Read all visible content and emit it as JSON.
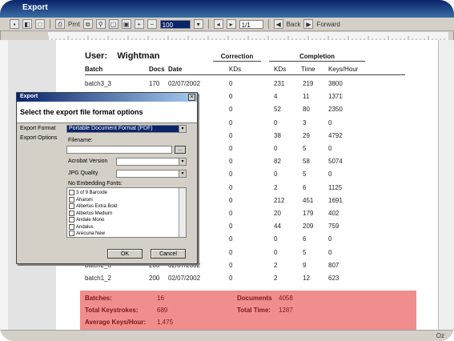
{
  "window": {
    "title": "Export"
  },
  "toolbar": {
    "print_label": "Prnt",
    "zoom_value": "100",
    "page_value": "1/1",
    "back_label": "Back",
    "forward_label": "Forward"
  },
  "report": {
    "user_label": "User:",
    "user_name": "Wightman",
    "headers": {
      "batch": "Batch",
      "docs": "Docs",
      "date": "Date",
      "correction_group": "Correction",
      "corr_kds": "KDs",
      "completion_group": "Completion",
      "comp_kds": "KDs",
      "time": "Time",
      "keys_per_hour": "Keys/Hour"
    },
    "rows": [
      {
        "batch": "batch3_3",
        "docs": "170",
        "date": "02/07/2002",
        "corr": "0",
        "kds": "231",
        "time": "219",
        "kph": "3800"
      },
      {
        "batch": "",
        "docs": "",
        "date": "02",
        "corr": "0",
        "kds": "4",
        "time": "11",
        "kph": "1371"
      },
      {
        "batch": "",
        "docs": "",
        "date": "02",
        "corr": "0",
        "kds": "52",
        "time": "80",
        "kph": "2350"
      },
      {
        "batch": "",
        "docs": "",
        "date": "02",
        "corr": "0",
        "kds": "0",
        "time": "3",
        "kph": "0"
      },
      {
        "batch": "",
        "docs": "",
        "date": "02",
        "corr": "0",
        "kds": "38",
        "time": "29",
        "kph": "4792"
      },
      {
        "batch": "",
        "docs": "",
        "date": "02",
        "corr": "0",
        "kds": "0",
        "time": "5",
        "kph": "0"
      },
      {
        "batch": "",
        "docs": "",
        "date": "02",
        "corr": "0",
        "kds": "82",
        "time": "58",
        "kph": "5074"
      },
      {
        "batch": "",
        "docs": "",
        "date": "02",
        "corr": "0",
        "kds": "0",
        "time": "5",
        "kph": "0"
      },
      {
        "batch": "",
        "docs": "",
        "date": "02",
        "corr": "0",
        "kds": "2",
        "time": "6",
        "kph": "1125"
      },
      {
        "batch": "",
        "docs": "",
        "date": "02",
        "corr": "0",
        "kds": "212",
        "time": "451",
        "kph": "1691"
      },
      {
        "batch": "",
        "docs": "",
        "date": "02",
        "corr": "0",
        "kds": "20",
        "time": "179",
        "kph": "402"
      },
      {
        "batch": "",
        "docs": "",
        "date": "02",
        "corr": "0",
        "kds": "44",
        "time": "209",
        "kph": "759"
      },
      {
        "batch": "",
        "docs": "",
        "date": "02",
        "corr": "0",
        "kds": "0",
        "time": "6",
        "kph": "0"
      },
      {
        "batch": "",
        "docs": "",
        "date": "02",
        "corr": "0",
        "kds": "0",
        "time": "5",
        "kph": "0"
      },
      {
        "batch": "batch2_6",
        "docs": "200",
        "date": "02/07/2002",
        "corr": "0",
        "kds": "2",
        "time": "9",
        "kph": "807"
      },
      {
        "batch": "batch1_2",
        "docs": "200",
        "date": "02/07/2002",
        "corr": "0",
        "kds": "2",
        "time": "12",
        "kph": "623"
      }
    ],
    "summary": {
      "batches_label": "Batches:",
      "batches_value": "16",
      "documents_label": "Documents",
      "documents_value": "4058",
      "keystrokes_label": "Total Keystrokes:",
      "keystrokes_value": "689",
      "total_time_label": "Total Time:",
      "total_time_value": "1287",
      "avg_label": "Average Keys/Hour:",
      "avg_value": "1,475"
    }
  },
  "dialog": {
    "title": "Export",
    "heading": "Select the export file format options",
    "export_format_label": "Export Format",
    "export_format_value": "Portable Document Format (PDF)",
    "export_options_label": "Export Options",
    "filename_label": "Filename:",
    "filename_value": "",
    "browse_label": "...",
    "acrobat_label": "Acrobat Version",
    "acrobat_value": "",
    "jpg_label": "JPG Quality",
    "jpg_value": "",
    "fonts_label": "No Embedding Fonts:",
    "fonts": [
      "3 of 9 Barcode",
      "Aharoni",
      "Albertus Extra Bold",
      "Albertus Medium",
      "Andale Mono",
      "Andalus",
      "Arecuna New"
    ],
    "ok_label": "OK",
    "cancel_label": "Cancel"
  },
  "status": {
    "text": "Oz"
  }
}
